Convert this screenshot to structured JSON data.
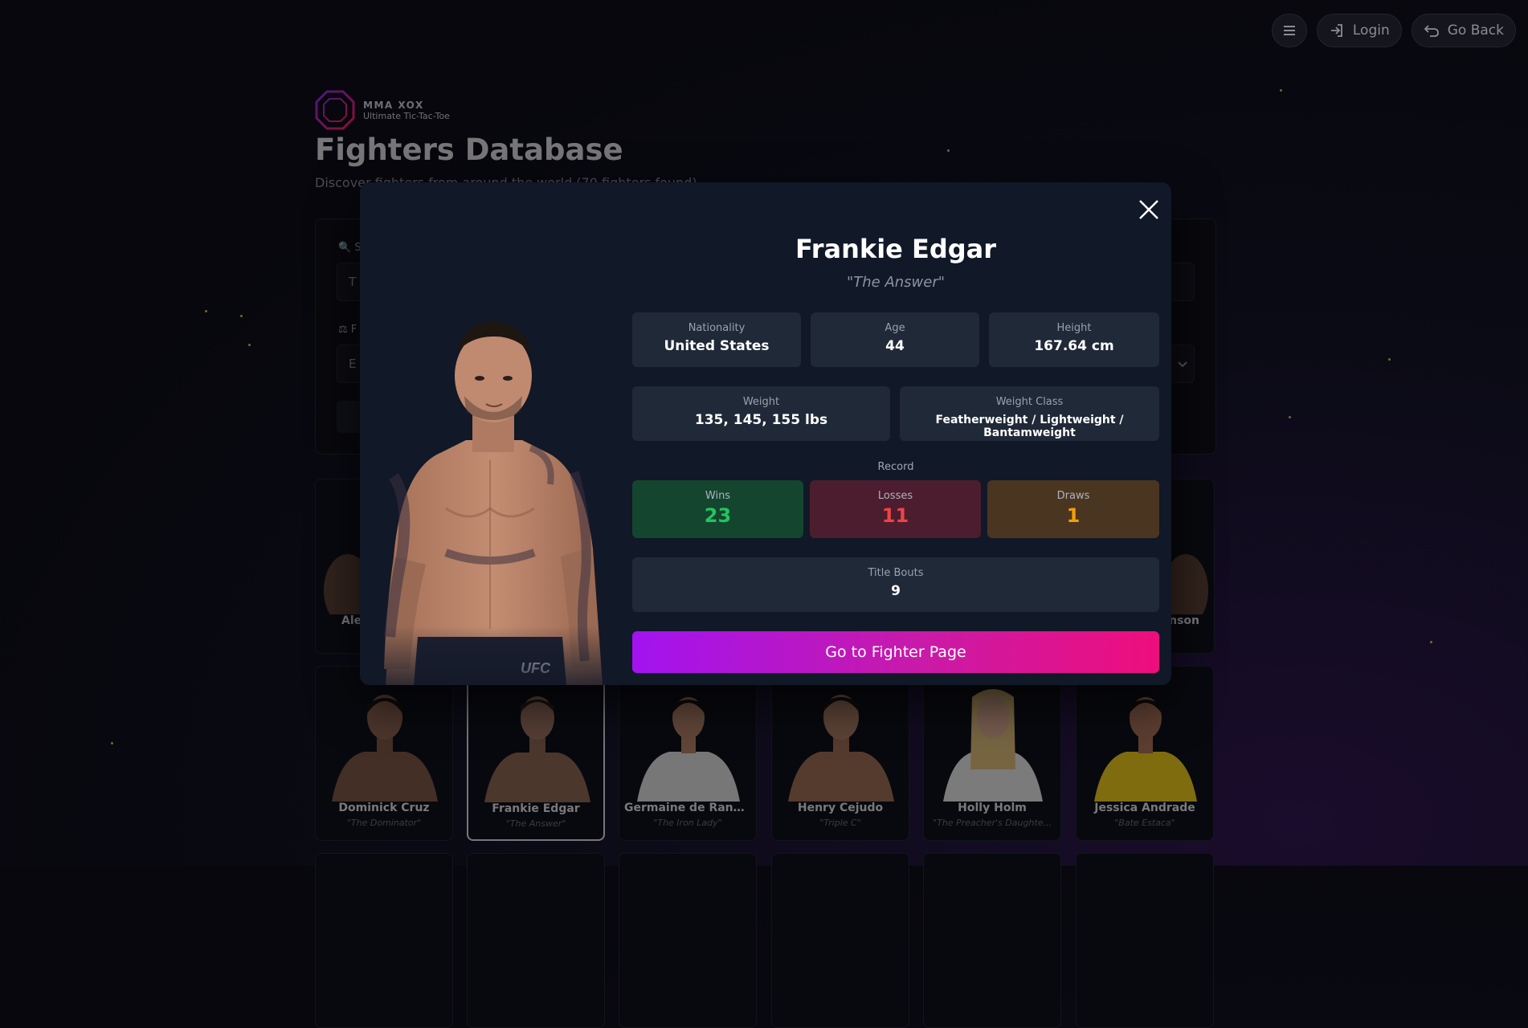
{
  "topbar": {
    "menu_icon": "hamburger-icon",
    "login_label": "Login",
    "go_back_label": "Go Back"
  },
  "brand": {
    "name": "MMA XOX",
    "tagline": "Ultimate Tic-Tac-Toe"
  },
  "page": {
    "title": "Fighters Database",
    "subtitle": "Discover fighters from around the world (70 fighters found)"
  },
  "filters": {
    "search_label": "S",
    "search_placeholder": "T",
    "filter_label": "F",
    "filter_value": "E"
  },
  "grid": {
    "row1_left_name": "Ale",
    "row1_right_name": "inson",
    "row1_right_nick": "o\"",
    "row2": [
      {
        "name": "Dominick Cruz",
        "nickname": "\"The Dominator\""
      },
      {
        "name": "Frankie Edgar",
        "nickname": "\"The Answer\""
      },
      {
        "name": "Germaine de Randa...",
        "nickname": "\"The Iron Lady\""
      },
      {
        "name": "Henry Cejudo",
        "nickname": "\"Triple C\""
      },
      {
        "name": "Holly Holm",
        "nickname": "\"The Preacher's Daughte..."
      },
      {
        "name": "Jessica Andrade",
        "nickname": "\"Bate Estaca\""
      }
    ]
  },
  "modal": {
    "name": "Frankie Edgar",
    "nickname": "\"The Answer\"",
    "nationality_label": "Nationality",
    "nationality": "United States",
    "age_label": "Age",
    "age": "44",
    "height_label": "Height",
    "height": "167.64 cm",
    "weight_label": "Weight",
    "weight": "135, 145, 155 lbs",
    "weight_class_label": "Weight Class",
    "weight_class": "Featherweight / Lightweight / Bantamweight",
    "record_label": "Record",
    "wins_label": "Wins",
    "wins": "23",
    "losses_label": "Losses",
    "losses": "11",
    "draws_label": "Draws",
    "draws": "1",
    "title_bouts_label": "Title Bouts",
    "title_bouts": "9",
    "cta_label": "Go to Fighter Page",
    "close_icon": "close-icon",
    "short_logo": "UFC"
  },
  "colors": {
    "wins_bg": "#14452f",
    "wins_text": "#22c55e",
    "losses_bg": "#4c1d2e",
    "losses_text": "#ef4444",
    "draws_bg": "#4a3620",
    "draws_text": "#f59e0b",
    "cta_start": "#a213f0",
    "cta_end": "#ee0e7c"
  }
}
